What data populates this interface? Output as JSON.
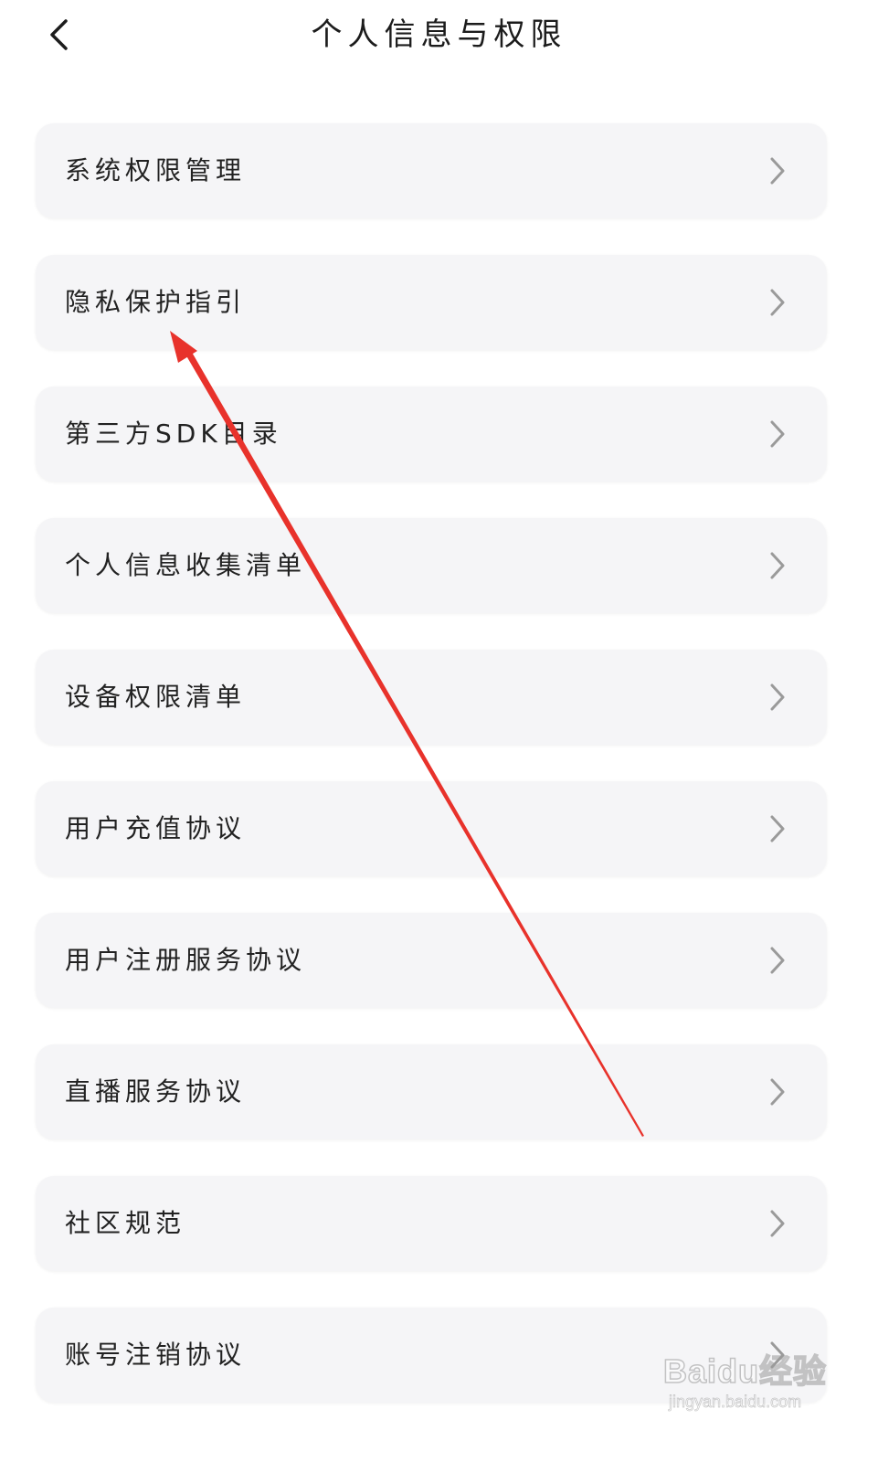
{
  "header": {
    "title": "个人信息与权限",
    "back_icon": "chevron-left-icon"
  },
  "menu": {
    "items": [
      {
        "label": "系统权限管理"
      },
      {
        "label": "隐私保护指引"
      },
      {
        "label": "第三方SDK目录"
      },
      {
        "label": "个人信息收集清单"
      },
      {
        "label": "设备权限清单"
      },
      {
        "label": "用户充值协议"
      },
      {
        "label": "用户注册服务协议"
      },
      {
        "label": "直播服务协议"
      },
      {
        "label": "社区规范"
      },
      {
        "label": "账号注销协议"
      }
    ],
    "chevron_icon": "chevron-right-icon"
  },
  "annotation": {
    "color": "#e8322b",
    "icon": "red-arrow"
  },
  "watermark": {
    "brand": "Baidu经验",
    "url": "jingyan.baidu.com"
  }
}
